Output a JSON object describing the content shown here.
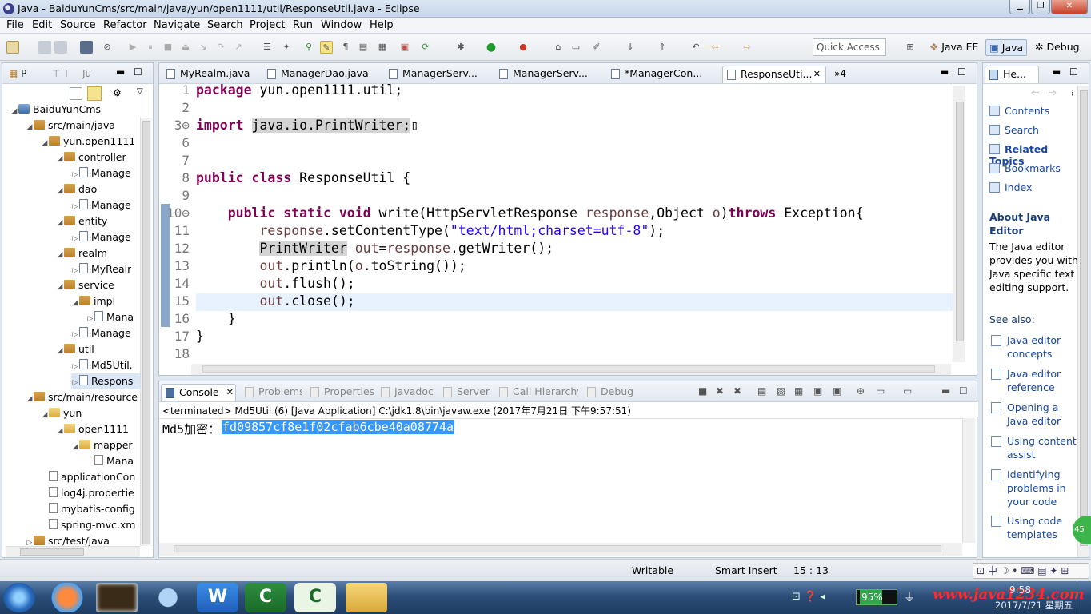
{
  "window": {
    "title": "Java - BaiduYunCms/src/main/java/yun/open1111/util/ResponseUtil.java - Eclipse"
  },
  "menu": [
    "File",
    "Edit",
    "Source",
    "Refactor",
    "Navigate",
    "Search",
    "Project",
    "Run",
    "Window",
    "Help"
  ],
  "toolbar": {
    "quick_access": "Quick Access",
    "perspectives": [
      "Java EE",
      "Java",
      "Debug"
    ]
  },
  "explorer": {
    "tabs": [
      "P",
      "T",
      "Ju"
    ],
    "items": [
      {
        "label": "BaiduYunCms",
        "icon": "project-icon",
        "depth": 0
      },
      {
        "label": "src/main/java",
        "icon": "source-folder-icon",
        "depth": 1
      },
      {
        "label": "yun.open1111",
        "icon": "package-icon",
        "depth": 2
      },
      {
        "label": "controller",
        "icon": "package-icon",
        "depth": 3
      },
      {
        "label": "Manage",
        "icon": "java-file-icon",
        "depth": 4
      },
      {
        "label": "dao",
        "icon": "package-icon",
        "depth": 3
      },
      {
        "label": "Manage",
        "icon": "java-file-icon",
        "depth": 4
      },
      {
        "label": "entity",
        "icon": "package-icon",
        "depth": 3
      },
      {
        "label": "Manage",
        "icon": "java-file-icon",
        "depth": 4
      },
      {
        "label": "realm",
        "icon": "package-icon",
        "depth": 3
      },
      {
        "label": "MyRealr",
        "icon": "java-file-icon",
        "depth": 4
      },
      {
        "label": "service",
        "icon": "package-icon",
        "depth": 3
      },
      {
        "label": "impl",
        "icon": "package-icon",
        "depth": 4
      },
      {
        "label": "Mana",
        "icon": "java-file-icon",
        "depth": 5
      },
      {
        "label": "Manage",
        "icon": "java-file-icon",
        "depth": 4
      },
      {
        "label": "util",
        "icon": "package-icon",
        "depth": 3
      },
      {
        "label": "Md5Util.",
        "icon": "java-file-icon",
        "depth": 4
      },
      {
        "label": "Respons",
        "icon": "java-file-icon",
        "depth": 4
      },
      {
        "label": "src/main/resource",
        "icon": "source-folder-icon",
        "depth": 1
      },
      {
        "label": "yun",
        "icon": "folder-icon",
        "depth": 2
      },
      {
        "label": "open1111",
        "icon": "folder-icon",
        "depth": 3
      },
      {
        "label": "mapper",
        "icon": "folder-icon",
        "depth": 4
      },
      {
        "label": "Mana",
        "icon": "xml-file-icon",
        "depth": 5
      },
      {
        "label": "applicationCon",
        "icon": "xml-file-icon",
        "depth": 2
      },
      {
        "label": "log4j.propertie",
        "icon": "properties-file-icon",
        "depth": 2
      },
      {
        "label": "mybatis-config",
        "icon": "xml-file-icon",
        "depth": 2
      },
      {
        "label": "spring-mvc.xm",
        "icon": "xml-file-icon",
        "depth": 2
      },
      {
        "label": "src/test/java",
        "icon": "source-folder-icon",
        "depth": 1
      }
    ]
  },
  "editor": {
    "tabs": [
      "MyRealm.java",
      "ManagerDao.java",
      "ManagerServ...",
      "ManagerServ...",
      "*ManagerCon...",
      "ResponseUti..."
    ],
    "overflow": "»4",
    "lines": [
      {
        "n": "1",
        "tokens": [
          {
            "t": "package",
            "c": "kw"
          },
          {
            "t": " yun.open1111.util;"
          }
        ]
      },
      {
        "n": "2",
        "tokens": []
      },
      {
        "n": "3⊕",
        "tokens": [
          {
            "t": "import",
            "c": "kw"
          },
          {
            "t": " "
          },
          {
            "t": "java.io.PrintWriter;",
            "c": "hl"
          },
          {
            "t": "▯"
          }
        ]
      },
      {
        "n": "6",
        "tokens": []
      },
      {
        "n": "7",
        "tokens": []
      },
      {
        "n": "8",
        "tokens": [
          {
            "t": "public",
            "c": "kw"
          },
          {
            "t": " "
          },
          {
            "t": "class",
            "c": "kw"
          },
          {
            "t": " ResponseUtil {"
          }
        ]
      },
      {
        "n": "9",
        "tokens": []
      },
      {
        "n": "10⊖",
        "tokens": [
          {
            "t": "    "
          },
          {
            "t": "public",
            "c": "kw"
          },
          {
            "t": " "
          },
          {
            "t": "static",
            "c": "kw"
          },
          {
            "t": " "
          },
          {
            "t": "void",
            "c": "kw"
          },
          {
            "t": " write(HttpServletResponse "
          },
          {
            "t": "response",
            "c": "param"
          },
          {
            "t": ",Object "
          },
          {
            "t": "o",
            "c": "param"
          },
          {
            "t": ")"
          },
          {
            "t": "throws",
            "c": "kw"
          },
          {
            "t": " Exception{"
          }
        ]
      },
      {
        "n": "11",
        "tokens": [
          {
            "t": "        "
          },
          {
            "t": "response",
            "c": "param"
          },
          {
            "t": ".setContentType("
          },
          {
            "t": "\"text/html;charset=utf-8\"",
            "c": "str"
          },
          {
            "t": ");"
          }
        ]
      },
      {
        "n": "12",
        "tokens": [
          {
            "t": "        "
          },
          {
            "t": "PrintWriter",
            "c": "hl"
          },
          {
            "t": " "
          },
          {
            "t": "out",
            "c": "param"
          },
          {
            "t": "="
          },
          {
            "t": "response",
            "c": "param"
          },
          {
            "t": ".getWriter();"
          }
        ]
      },
      {
        "n": "13",
        "tokens": [
          {
            "t": "        "
          },
          {
            "t": "out",
            "c": "param"
          },
          {
            "t": ".println("
          },
          {
            "t": "o",
            "c": "param"
          },
          {
            "t": ".toString());"
          }
        ]
      },
      {
        "n": "14",
        "tokens": [
          {
            "t": "        "
          },
          {
            "t": "out",
            "c": "param"
          },
          {
            "t": ".flush();"
          }
        ]
      },
      {
        "n": "15",
        "tokens": [
          {
            "t": "        "
          },
          {
            "t": "out",
            "c": "param"
          },
          {
            "t": ".close();"
          }
        ]
      },
      {
        "n": "16",
        "tokens": [
          {
            "t": "    }"
          }
        ]
      },
      {
        "n": "17",
        "tokens": [
          {
            "t": "}"
          }
        ]
      },
      {
        "n": "18",
        "tokens": []
      }
    ]
  },
  "bottom": {
    "tabs": [
      "Console",
      "Problems",
      "Properties",
      "Javadoc",
      "Servers",
      "Call Hierarchy",
      "Debug"
    ],
    "status": "<terminated> Md5Util (6) [Java Application] C:\\jdk1.8\\bin\\javaw.exe (2017年7月21日 下午9:57:51)",
    "output_label": "Md5加密：",
    "output_value": "fd09857cf8e1f02cfab6cbe40a08774a"
  },
  "help": {
    "tab": "He...",
    "nav": [
      "Contents",
      "Search",
      "Related Topics",
      "Bookmarks",
      "Index"
    ],
    "heading": "About Java Editor",
    "body": "The Java editor provides you with Java specific text editing support.",
    "see_also": "See also:",
    "links": [
      "Java editor concepts",
      "Java editor reference",
      "Opening a Java editor",
      "Using content assist",
      "Identifying problems in your code",
      "Using code templates"
    ]
  },
  "statusbar": {
    "mode": "Writable",
    "insert": "Smart Insert",
    "position": "15 : 13"
  },
  "taskbar": {
    "battery": "95%",
    "watermark": "www.java1234.com",
    "time": "9:58",
    "date": "2017/7/21 星期五"
  },
  "colors": {
    "keyword": "#7f0055",
    "string": "#2a00ff",
    "selection": "#3399ff"
  }
}
